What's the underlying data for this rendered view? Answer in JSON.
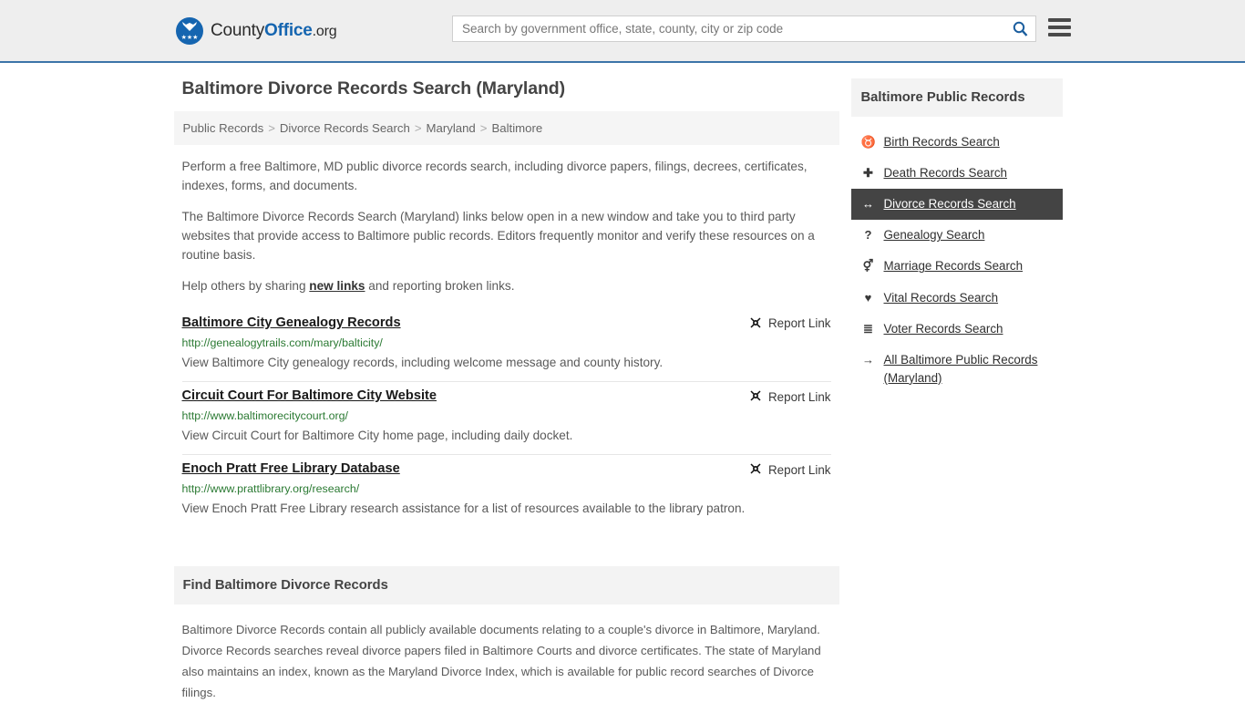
{
  "header": {
    "brand": {
      "part1": "County",
      "part2": "Office",
      "part3": ".org",
      "logo_icon": "eagle-logo-icon",
      "eagle_glyph": "ὔ",
      "stars_glyph": "★★★"
    },
    "search": {
      "placeholder": "Search by government office, state, county, city or zip code",
      "value": "",
      "button_icon": "search-icon"
    },
    "menu_icon": "hamburger-menu-icon",
    "accent_color": "#3c74a8",
    "background_color": "#eeeeee"
  },
  "page": {
    "title": "Baltimore Divorce Records Search (Maryland)"
  },
  "breadcrumb": {
    "separator": ">",
    "items": [
      {
        "label": "Public Records"
      },
      {
        "label": "Divorce Records Search"
      },
      {
        "label": "Maryland"
      },
      {
        "label": "Baltimore"
      }
    ]
  },
  "intro": {
    "p1": "Perform a free Baltimore, MD public divorce records search, including divorce papers, filings, decrees, certificates, indexes, forms, and documents.",
    "p2": "The Baltimore Divorce Records Search (Maryland) links below open in a new window and take you to third party websites that provide access to Baltimore public records. Editors frequently monitor and verify these resources on a routine basis.",
    "p3_before": "Help others by sharing ",
    "p3_link": "new links",
    "p3_after": " and reporting broken links."
  },
  "results": {
    "report_label": "Report Link",
    "report_icon": "broken-link-icon",
    "report_glyph": "⛓",
    "items": [
      {
        "title": "Baltimore City Genealogy Records",
        "url": "http://genealogytrails.com/mary/balticity/",
        "description": "View Baltimore City genealogy records, including welcome message and county history."
      },
      {
        "title": "Circuit Court For Baltimore City Website",
        "url": "http://www.baltimorecitycourt.org/",
        "description": "View Circuit Court for Baltimore City home page, including daily docket."
      },
      {
        "title": "Enoch Pratt Free Library Database",
        "url": "http://www.prattlibrary.org/research/",
        "description": "View Enoch Pratt Free Library research assistance for a list of resources available to the library patron."
      }
    ]
  },
  "find_section": {
    "heading": "Find Baltimore Divorce Records",
    "body": "Baltimore Divorce Records contain all publicly available documents relating to a couple's divorce in Baltimore, Maryland. Divorce Records searches reveal divorce papers filed in Baltimore Courts and divorce certificates. The state of Maryland also maintains an index, known as the Maryland Divorce Index, which is available for public record searches of Divorce filings."
  },
  "sidebar": {
    "heading": "Baltimore Public Records",
    "active_background": "#444444",
    "items": [
      {
        "label": "Birth Records Search",
        "icon": "baby-icon",
        "glyph": "♉",
        "active": false
      },
      {
        "label": "Death Records Search",
        "icon": "cross-icon",
        "glyph": "✚",
        "active": false
      },
      {
        "label": "Divorce Records Search",
        "icon": "arrows-left-right-icon",
        "glyph": "↔",
        "active": true
      },
      {
        "label": "Genealogy Search",
        "icon": "question-mark-icon",
        "glyph": "?",
        "active": false
      },
      {
        "label": "Marriage Records Search",
        "icon": "venus-mars-icon",
        "glyph": "⚥",
        "active": false
      },
      {
        "label": "Vital Records Search",
        "icon": "heartbeat-icon",
        "glyph": "♥",
        "active": false
      },
      {
        "label": "Voter Records Search",
        "icon": "ordered-list-icon",
        "glyph": "≣",
        "active": false
      },
      {
        "label": "All Baltimore Public Records (Maryland)",
        "icon": "arrow-right-icon",
        "glyph": "→",
        "active": false
      }
    ]
  }
}
